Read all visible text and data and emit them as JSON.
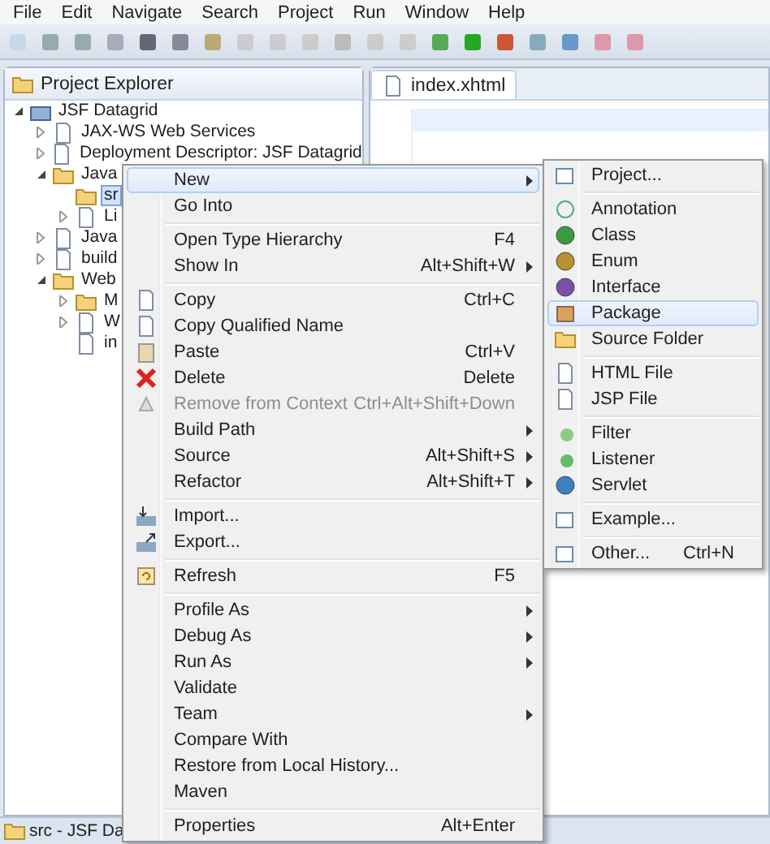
{
  "menu_bar": [
    {
      "label": "File"
    },
    {
      "label": "Edit"
    },
    {
      "label": "Navigate"
    },
    {
      "label": "Search"
    },
    {
      "label": "Project"
    },
    {
      "label": "Run"
    },
    {
      "label": "Window"
    },
    {
      "label": "Help"
    }
  ],
  "project_explorer": {
    "title": "Project Explorer",
    "tree": [
      {
        "label": "JSF Datagrid",
        "expanded": true,
        "selected": false,
        "children": [
          {
            "label": "JAX-WS Web Services",
            "expanded": false,
            "selected": false
          },
          {
            "label": "Deployment Descriptor: JSF Datagrid",
            "expanded": false,
            "selected": false
          },
          {
            "label": "Java",
            "expanded": true,
            "selected": false,
            "children": [
              {
                "label": "sr",
                "selected": true
              },
              {
                "label": "Li",
                "expanded": false,
                "selected": false
              }
            ]
          },
          {
            "label": "Java",
            "expanded": false,
            "selected": false
          },
          {
            "label": "build",
            "expanded": false,
            "selected": false
          },
          {
            "label": "Web",
            "expanded": true,
            "selected": false,
            "children": [
              {
                "label": "M",
                "expanded": false,
                "selected": false
              },
              {
                "label": "W",
                "expanded": false,
                "selected": false
              },
              {
                "label": "in",
                "selected": false
              }
            ]
          }
        ]
      }
    ]
  },
  "editor": {
    "tab": "index.xhtml"
  },
  "context_menu": {
    "items": [
      {
        "kind": "item",
        "label": "New",
        "submenu": true,
        "selected": true,
        "disabled": false
      },
      {
        "kind": "item",
        "label": "Go Into",
        "selected": false,
        "disabled": false
      },
      {
        "kind": "separator"
      },
      {
        "kind": "item",
        "label": "Open Type Hierarchy",
        "shortcut": "F4",
        "selected": false,
        "disabled": false
      },
      {
        "kind": "item",
        "label": "Show In",
        "shortcut": "Alt+Shift+W",
        "submenu": true,
        "selected": false,
        "disabled": false
      },
      {
        "kind": "separator"
      },
      {
        "kind": "item",
        "label": "Copy",
        "shortcut": "Ctrl+C",
        "selected": false,
        "disabled": false
      },
      {
        "kind": "item",
        "label": "Copy Qualified Name",
        "selected": false,
        "disabled": false
      },
      {
        "kind": "item",
        "label": "Paste",
        "shortcut": "Ctrl+V",
        "selected": false,
        "disabled": false
      },
      {
        "kind": "item",
        "label": "Delete",
        "shortcut": "Delete",
        "selected": false,
        "disabled": false
      },
      {
        "kind": "item",
        "label": "Remove from Context",
        "shortcut": "Ctrl+Alt+Shift+Down",
        "selected": false,
        "disabled": true
      },
      {
        "kind": "item",
        "label": "Build Path",
        "submenu": true,
        "selected": false,
        "disabled": false
      },
      {
        "kind": "item",
        "label": "Source",
        "shortcut": "Alt+Shift+S",
        "submenu": true,
        "selected": false,
        "disabled": false
      },
      {
        "kind": "item",
        "label": "Refactor",
        "shortcut": "Alt+Shift+T",
        "submenu": true,
        "selected": false,
        "disabled": false
      },
      {
        "kind": "separator"
      },
      {
        "kind": "item",
        "label": "Import...",
        "selected": false,
        "disabled": false
      },
      {
        "kind": "item",
        "label": "Export...",
        "selected": false,
        "disabled": false
      },
      {
        "kind": "separator"
      },
      {
        "kind": "item",
        "label": "Refresh",
        "shortcut": "F5",
        "selected": false,
        "disabled": false
      },
      {
        "kind": "separator"
      },
      {
        "kind": "item",
        "label": "Profile As",
        "submenu": true,
        "selected": false,
        "disabled": false
      },
      {
        "kind": "item",
        "label": "Debug As",
        "submenu": true,
        "selected": false,
        "disabled": false
      },
      {
        "kind": "item",
        "label": "Run As",
        "submenu": true,
        "selected": false,
        "disabled": false
      },
      {
        "kind": "item",
        "label": "Validate",
        "selected": false,
        "disabled": false
      },
      {
        "kind": "item",
        "label": "Team",
        "submenu": true,
        "selected": false,
        "disabled": false
      },
      {
        "kind": "item",
        "label": "Compare With",
        "selected": false,
        "disabled": false
      },
      {
        "kind": "item",
        "label": "Restore from Local History...",
        "selected": false,
        "disabled": false
      },
      {
        "kind": "item",
        "label": "Maven",
        "selected": false,
        "disabled": false
      },
      {
        "kind": "separator"
      },
      {
        "kind": "item",
        "label": "Properties",
        "shortcut": "Alt+Enter",
        "selected": false,
        "disabled": false
      }
    ]
  },
  "new_submenu": {
    "items": [
      {
        "kind": "item",
        "label": "Project...",
        "selected": false
      },
      {
        "kind": "separator"
      },
      {
        "kind": "item",
        "label": "Annotation",
        "selected": false
      },
      {
        "kind": "item",
        "label": "Class",
        "selected": false
      },
      {
        "kind": "item",
        "label": "Enum",
        "selected": false
      },
      {
        "kind": "item",
        "label": "Interface",
        "selected": false
      },
      {
        "kind": "item",
        "label": "Package",
        "selected": true
      },
      {
        "kind": "item",
        "label": "Source Folder",
        "selected": false
      },
      {
        "kind": "separator"
      },
      {
        "kind": "item",
        "label": "HTML File",
        "selected": false
      },
      {
        "kind": "item",
        "label": "JSP File",
        "selected": false
      },
      {
        "kind": "separator"
      },
      {
        "kind": "item",
        "label": "Filter",
        "selected": false
      },
      {
        "kind": "item",
        "label": "Listener",
        "selected": false
      },
      {
        "kind": "item",
        "label": "Servlet",
        "selected": false
      },
      {
        "kind": "separator"
      },
      {
        "kind": "item",
        "label": "Example...",
        "selected": false
      },
      {
        "kind": "separator"
      },
      {
        "kind": "item",
        "label": "Other...",
        "shortcut": "Ctrl+N",
        "selected": false
      }
    ]
  },
  "status_bar": {
    "text": "src - JSF Da"
  }
}
